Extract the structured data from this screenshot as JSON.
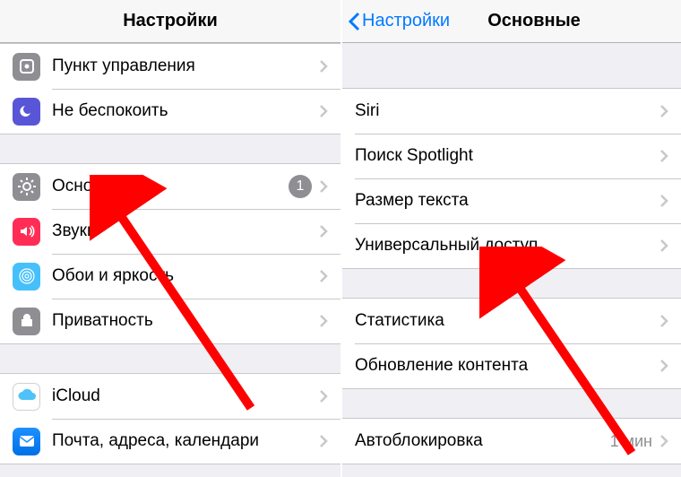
{
  "left": {
    "title": "Настройки",
    "group1": [
      {
        "icon": "control-center-icon",
        "label": "Пункт управления"
      },
      {
        "icon": "dnd-icon",
        "label": "Не беспокоить"
      }
    ],
    "group2": [
      {
        "icon": "general-icon",
        "label": "Основные",
        "badge": "1"
      },
      {
        "icon": "sounds-icon",
        "label": "Звуки"
      },
      {
        "icon": "wallpaper-icon",
        "label": "Обои и яркость"
      },
      {
        "icon": "privacy-icon",
        "label": "Приватность"
      }
    ],
    "group3": [
      {
        "icon": "icloud-icon",
        "label": "iCloud"
      },
      {
        "icon": "mail-icon",
        "label": "Почта, адреса, календари"
      }
    ]
  },
  "right": {
    "back": "Настройки",
    "title": "Основные",
    "group1": [
      {
        "label": "Siri"
      },
      {
        "label": "Поиск Spotlight"
      },
      {
        "label": "Размер текста"
      },
      {
        "label": "Универсальный доступ"
      }
    ],
    "group2": [
      {
        "label": "Статистика"
      },
      {
        "label": "Обновление контента"
      }
    ],
    "group3": [
      {
        "label": "Автоблокировка",
        "value": "1 мин"
      }
    ]
  }
}
